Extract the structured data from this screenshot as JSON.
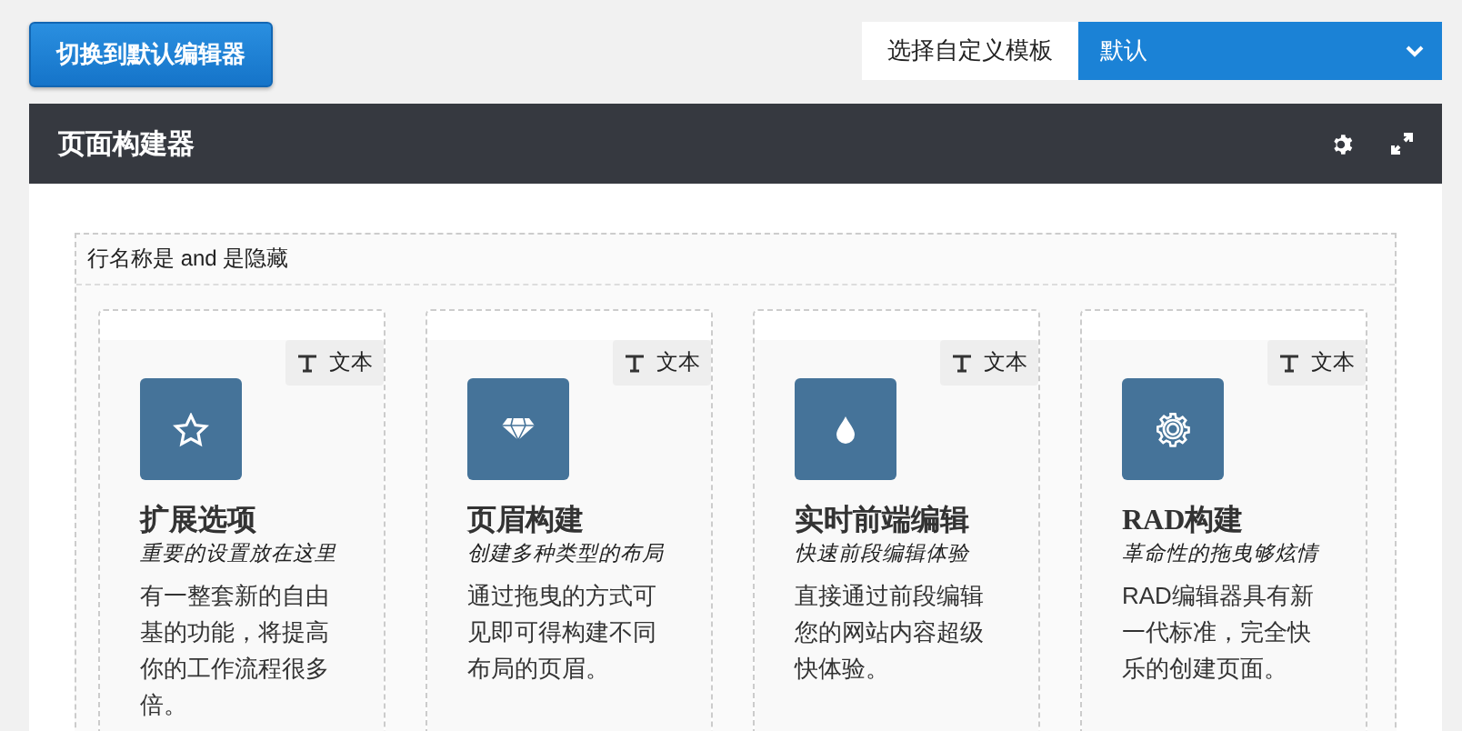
{
  "switch_button": {
    "label": "切换到默认编辑器"
  },
  "template_select": {
    "label": "选择自定义模板",
    "value": "默认"
  },
  "builder": {
    "title": "页面构建器"
  },
  "row": {
    "label": "行名称是 and 是隐藏"
  },
  "columns": [
    {
      "tag": "文本",
      "title": "扩展选项",
      "subtitle": "重要的设置放在这里",
      "text": "有一整套新的自由基的功能，将提高你的工作流程很多倍。"
    },
    {
      "tag": "文本",
      "title": "页眉构建",
      "subtitle": "创建多种类型的布局",
      "text": "通过拖曳的方式可见即可得构建不同布局的页眉。"
    },
    {
      "tag": "文本",
      "title": "实时前端编辑",
      "subtitle": "快速前段编辑体验",
      "text": "直接通过前段编辑您的网站内容超级快体验。"
    },
    {
      "tag": "文本",
      "title": "RAD构建",
      "subtitle": "革命性的拖曳够炫情",
      "text": "RAD编辑器具有新一代标准，完全快乐的创建页面。"
    }
  ]
}
